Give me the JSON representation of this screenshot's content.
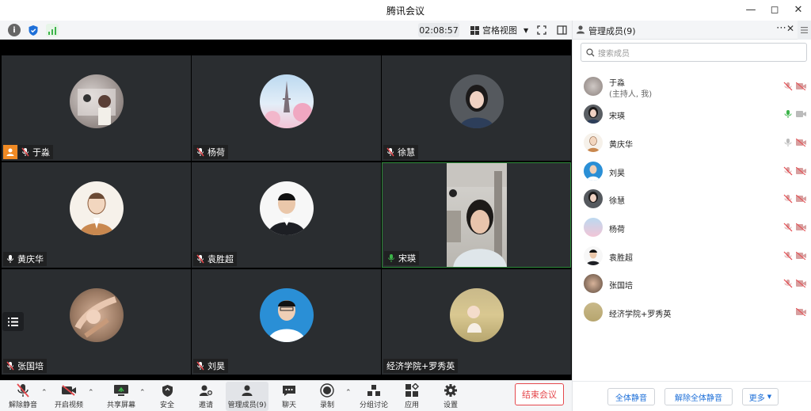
{
  "window": {
    "title": "腾讯会议"
  },
  "infobar": {
    "timer": "02:08:57",
    "view_mode": "宫格视图"
  },
  "tiles": [
    {
      "name": "于淼",
      "host": true
    },
    {
      "name": "杨荷"
    },
    {
      "name": "徐慧"
    },
    {
      "name": "黄庆华",
      "mic": "on"
    },
    {
      "name": "袁胜超"
    },
    {
      "name": "宋瑛",
      "mic": "green",
      "video": true
    },
    {
      "name": "张国培"
    },
    {
      "name": "刘昊"
    },
    {
      "name": "经济学院+罗秀英",
      "nomic": true
    }
  ],
  "toolbar": {
    "unmute": "解除静音",
    "start_video": "开启视频",
    "share_screen": "共享屏幕",
    "security": "安全",
    "invite": "邀请",
    "manage_members": "管理成员(9)",
    "chat": "聊天",
    "record": "录制",
    "breakout": "分组讨论",
    "apps": "应用",
    "settings": "设置",
    "end_meeting": "结束会议"
  },
  "panel": {
    "title": "管理成员(9)",
    "search_placeholder": "搜索成员",
    "members": [
      {
        "name": "于淼",
        "sub": "(主持人, 我)",
        "mic": "muted"
      },
      {
        "name": "宋瑛",
        "mic": "speaking"
      },
      {
        "name": "黄庆华",
        "mic": "on"
      },
      {
        "name": "刘昊",
        "mic": "muted"
      },
      {
        "name": "徐慧",
        "mic": "muted"
      },
      {
        "name": "杨荷",
        "mic": "muted"
      },
      {
        "name": "袁胜超",
        "mic": "muted"
      },
      {
        "name": "张国培",
        "mic": "muted"
      },
      {
        "name": "经济学院+罗秀英",
        "mic": "none"
      }
    ],
    "footer": {
      "mute_all": "全体静音",
      "unmute_all": "解除全体静音",
      "more": "更多"
    }
  },
  "colors": {
    "accent": "#1d6fd8",
    "danger": "#e5484d",
    "host_badge": "#f08a24",
    "speaking": "#3cb44a"
  }
}
